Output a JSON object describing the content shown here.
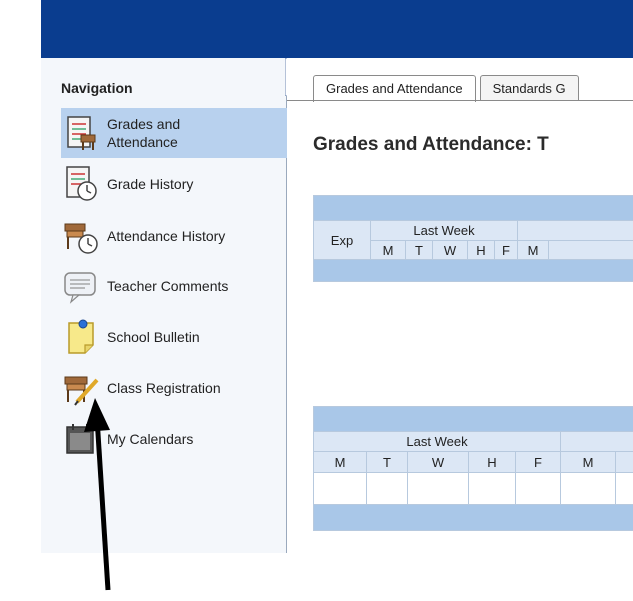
{
  "navigation": {
    "title": "Navigation",
    "items": [
      {
        "label": "Grades and Attendance",
        "line1": "Grades and",
        "line2": "Attendance",
        "icon": "gradebook-icon",
        "active": true
      },
      {
        "label": "Grade History",
        "icon": "grade-history-icon"
      },
      {
        "label": "Attendance History",
        "icon": "attendance-history-icon"
      },
      {
        "label": "Teacher Comments",
        "icon": "comment-bubble-icon"
      },
      {
        "label": "School Bulletin",
        "icon": "bulletin-note-icon"
      },
      {
        "label": "Class Registration",
        "icon": "desk-pencil-icon"
      },
      {
        "label": "My Calendars",
        "icon": "calendar-icon"
      }
    ]
  },
  "tabs": [
    {
      "label": "Grades and Attendance",
      "active": true
    },
    {
      "label": "Standards G"
    }
  ],
  "page_title": "Grades and Attendance: T",
  "table1": {
    "exp_header": "Exp",
    "week_label": "Last Week",
    "days": [
      "M",
      "T",
      "W",
      "H",
      "F",
      "M"
    ]
  },
  "table2": {
    "week_label": "Last Week",
    "days": [
      "M",
      "T",
      "W",
      "H",
      "F",
      "M"
    ]
  },
  "colors": {
    "topbar": "#0a3d8f",
    "active_nav": "#b8d1ee",
    "table_band": "#a9c7e8",
    "table_header": "#dce7f5"
  }
}
